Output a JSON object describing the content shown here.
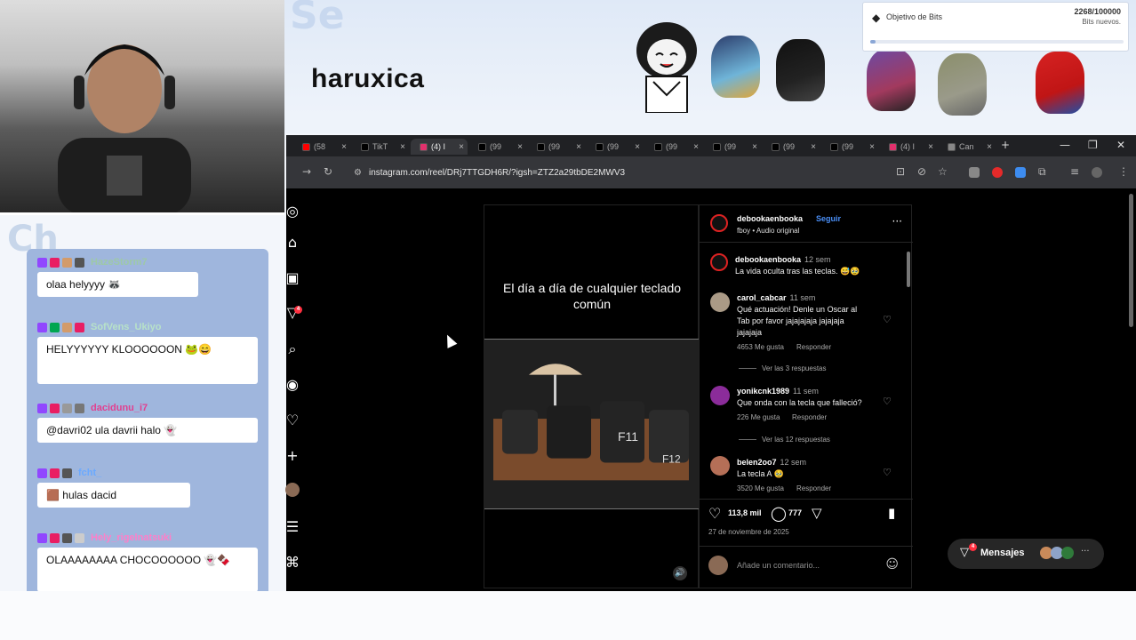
{
  "overlay": {
    "streamer_name": "haruxica",
    "bits_goal_label": "Objetivo de Bits",
    "bits_count": "2268/100000",
    "bits_sub": "Bits nuevos.",
    "bits_progress": 0.02
  },
  "chat": {
    "messages": [
      {
        "user": "HazeStorm7",
        "user_color": "#9ec9a6",
        "text": "olaa helyyyy"
      },
      {
        "user": "SofVens_Ukiyo",
        "user_color": "#b7e1c8",
        "text": "HELYYYYYY KLOOOOOON"
      },
      {
        "user": "dacidunu_i7",
        "user_color": "#e23f8f",
        "text": "@davri02 ula davrii halo"
      },
      {
        "user": "fcht_",
        "user_color": "#6aa9ff",
        "text": "hulas dacid"
      },
      {
        "user": "Hely_rigelnatsuki",
        "user_color": "#ff7ec8",
        "text": "OLAAAAAAAA CHOCOOOOOO"
      }
    ]
  },
  "browser": {
    "tabs": [
      {
        "label": "(58",
        "color": "#ff0000"
      },
      {
        "label": "TikT",
        "color": "#000000"
      },
      {
        "label": "(4) I",
        "color": "#e1306c",
        "active": true
      },
      {
        "label": "(99",
        "color": "#000000"
      },
      {
        "label": "(99",
        "color": "#000000"
      },
      {
        "label": "(99",
        "color": "#000000"
      },
      {
        "label": "(99",
        "color": "#000000"
      },
      {
        "label": "(99",
        "color": "#000000"
      },
      {
        "label": "(99",
        "color": "#000000"
      },
      {
        "label": "(99",
        "color": "#000000"
      },
      {
        "label": "(4) I",
        "color": "#e1306c"
      },
      {
        "label": "Can",
        "color": "#888888"
      }
    ],
    "url": "instagram.com/reel/DRj7TTGDH6R/?igsh=ZTZ2a29tbDE2MWV3"
  },
  "instagram": {
    "notif_count": "4",
    "reel_caption": "El día a día de cualquier teclado común",
    "author": "debookaenbooka",
    "follow_label": "Seguir",
    "audio": "fboy • Audio original",
    "caption_author": "debookaenbooka",
    "caption_time": "12 sem",
    "caption_text": "La vida oculta tras las teclas. 😅🥹",
    "comments": [
      {
        "author": "carol_cabcar",
        "time": "11 sem",
        "text": "Qué actuación! Denle un Oscar al Tab por favor jajajajaja jajajaja jajajaja",
        "likes": "4653 Me gusta",
        "reply": "Responder",
        "replies": "Ver las 3 respuestas"
      },
      {
        "author": "yonikcnk1989",
        "time": "11 sem",
        "text": "Que onda con la tecla que falleció?",
        "likes": "226 Me gusta",
        "reply": "Responder",
        "replies": "Ver las 12 respuestas"
      },
      {
        "author": "belen2oo7",
        "time": "12 sem",
        "text": "La tecla A 🥹",
        "likes": "3520 Me gusta",
        "reply": "Responder"
      }
    ],
    "like_count": "113,8 mil",
    "comment_count": "777",
    "post_date": "27 de noviembre de 2025",
    "add_comment_placeholder": "Añade un comentario...",
    "messages_label": "Mensajes",
    "messages_badge": "4"
  },
  "colors": {
    "ig_notification": "#ff3040",
    "follow": "#4a8ff7",
    "chat_panel": "#9fb6dd"
  }
}
